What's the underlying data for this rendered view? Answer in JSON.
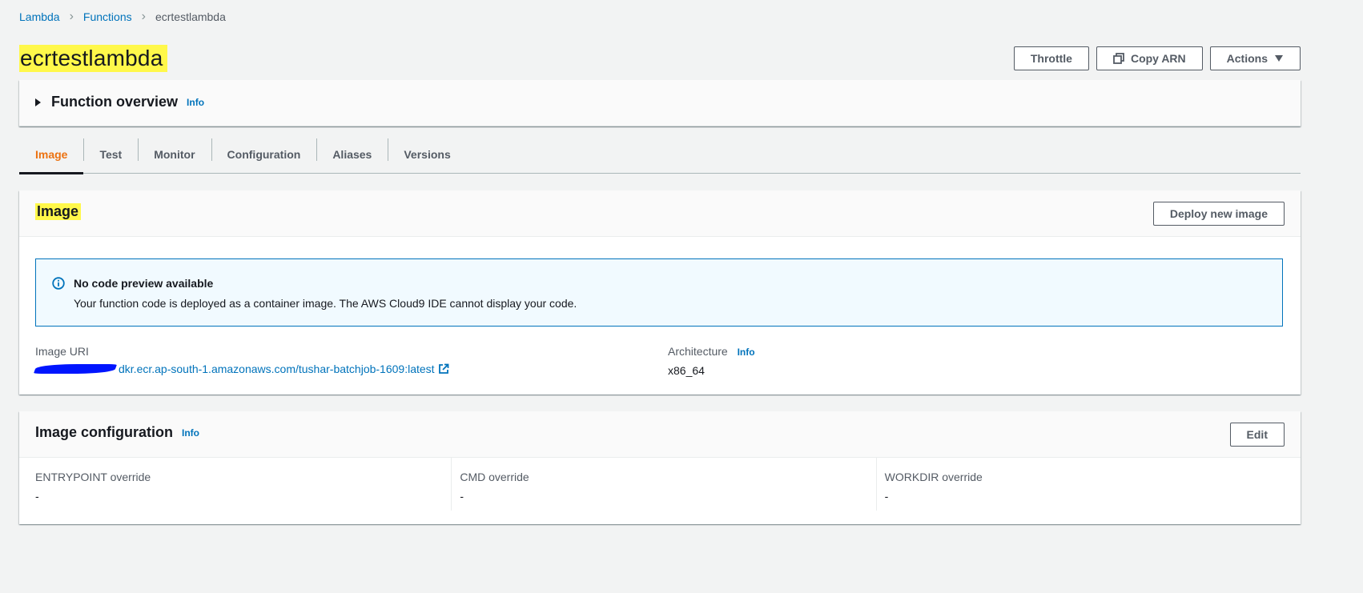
{
  "breadcrumb": [
    "Lambda",
    "Functions",
    "ecrtestlambda"
  ],
  "page_title": "ecrtestlambda",
  "header_buttons": {
    "throttle": "Throttle",
    "copy_arn": "Copy ARN",
    "actions": "Actions"
  },
  "overview": {
    "title": "Function overview",
    "info": "Info"
  },
  "tabs": [
    "Image",
    "Test",
    "Monitor",
    "Configuration",
    "Aliases",
    "Versions"
  ],
  "active_tab": "Image",
  "image_panel": {
    "title": "Image",
    "deploy_button": "Deploy new image",
    "alert": {
      "title": "No code preview available",
      "body": "Your function code is deployed as a container image. The AWS Cloud9 IDE cannot display your code."
    },
    "image_uri_label": "Image URI",
    "image_uri_value": "dkr.ecr.ap-south-1.amazonaws.com/tushar-batchjob-1609:latest",
    "architecture_label": "Architecture",
    "architecture_info": "Info",
    "architecture_value": "x86_64"
  },
  "config_panel": {
    "title": "Image configuration",
    "info": "Info",
    "edit_button": "Edit",
    "fields": [
      {
        "label": "ENTRYPOINT override",
        "value": "-"
      },
      {
        "label": "CMD override",
        "value": "-"
      },
      {
        "label": "WORKDIR override",
        "value": "-"
      }
    ]
  },
  "colors": {
    "link": "#0073bb",
    "active_tab": "#ec7211",
    "highlight": "#fff84a",
    "redaction": "#0015ff"
  }
}
